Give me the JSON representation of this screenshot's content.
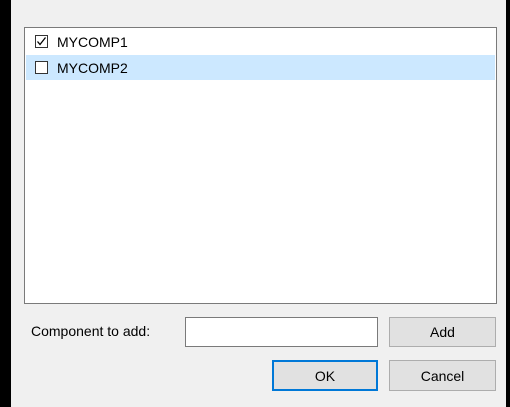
{
  "list": {
    "items": [
      {
        "label": "MYCOMP1",
        "checked": true,
        "selected": false
      },
      {
        "label": "MYCOMP2",
        "checked": false,
        "selected": true
      }
    ]
  },
  "add_row": {
    "label": "Component to add:",
    "input_value": "",
    "add_label": "Add"
  },
  "buttons": {
    "ok_label": "OK",
    "cancel_label": "Cancel"
  },
  "colors": {
    "selection": "#cce8ff",
    "focus_border": "#0078d7",
    "button_face": "#e1e1e1"
  }
}
